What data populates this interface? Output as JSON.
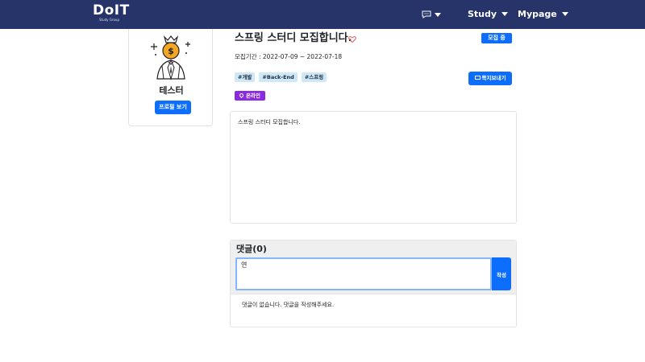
{
  "nav": {
    "logo_main": "DoIT",
    "logo_sub": "Study Group",
    "study_label": "Study",
    "mypage_label": "Mypage"
  },
  "profile": {
    "name": "테스터",
    "button_label": "프로필 보기"
  },
  "post": {
    "title": "스프링 스터디 모집합니다.",
    "status": "모집 중",
    "period": "모집기간 : 2022-07-09 ~ 2022-07-18",
    "tags": [
      "#개발",
      "#Back-End",
      "#스프링"
    ],
    "message_button": "쪽지보내기",
    "location": "온라인",
    "content": "스프링 스터디 모집합니다."
  },
  "comments": {
    "title": "댓글(0)",
    "input_value": "연",
    "submit_label": "작성",
    "empty_message": "댓글이 없습니다. 댓글을 작성해주세요."
  },
  "colors": {
    "navbar": "#27346a",
    "primary": "#0d6efd",
    "location_badge": "#8a2be2",
    "tag_bg": "#cfe8f7",
    "heart": "#e04848",
    "avatar_accent": "#f5a623"
  },
  "icons": {
    "chat": "chat-bubble-icon",
    "heart": "heart-outline-icon",
    "mail": "mail-icon",
    "pin": "map-pin-icon",
    "avatar": "money-bag-person-icon"
  }
}
